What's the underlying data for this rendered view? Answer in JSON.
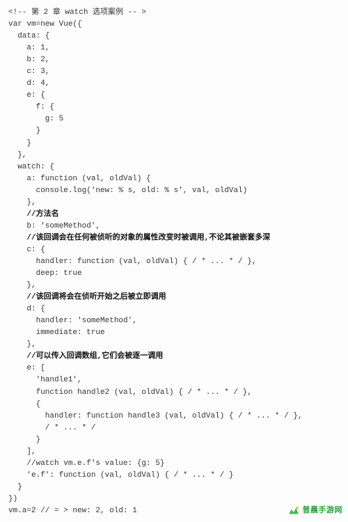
{
  "code": {
    "l01": "<!-- 第 2 章 watch 选项案例 -- >",
    "l02": "var vm=new Vue({",
    "l03": "  data: {",
    "l04": "",
    "l05": "    a: 1,",
    "l06": "    b: 2,",
    "l07": "    c: 3,",
    "l08": "    d: 4,",
    "l09": "    e: {",
    "l10": "      f: {",
    "l11": "        g: 5",
    "l12": "      }",
    "l13": "    }",
    "l14": "  },",
    "l15": "  watch: {",
    "l16": "    a: function (val, oldVal) {",
    "l17": "      console.log('new: % s, old: % s', val, oldVal)",
    "l18": "    },",
    "l19": "    //方法名",
    "l20": "    b: 'someMethod',",
    "l21": "    //该回调会在任何被侦听的对象的属性改变时被调用,不论其被嵌套多深",
    "l22": "    c: {",
    "l23": "      handler: function (val, oldVal) { / * ... * / },",
    "l24": "      deep: true",
    "l25": "    },",
    "l26": "    //该回调将会在侦听开始之后被立即调用",
    "l27": "    d: {",
    "l28": "      handler: 'someMethod',",
    "l29": "      immediate: true",
    "l30": "    },",
    "l31": "    //可以传入回调数组,它们会被逐一调用",
    "l32": "    e: [",
    "l33": "      'handle1',",
    "l34": "      function handle2 (val, oldVal) { / * ... * / },",
    "l35": "      {",
    "l36": "        handler: function handle3 (val, oldVal) { / * ... * / },",
    "l37": "        / * ... * /",
    "l38": "      }",
    "l39": "    ],",
    "l40": "    //watch vm.e.f's value: {g: 5}",
    "l41": "    'e.f': function (val, oldVal) { / * ... * / }",
    "l42": "  }",
    "l43": "})",
    "l44": "vm.a=2 // = > new: 2, old: 1"
  },
  "watermark": {
    "text": "普晨手游网"
  }
}
